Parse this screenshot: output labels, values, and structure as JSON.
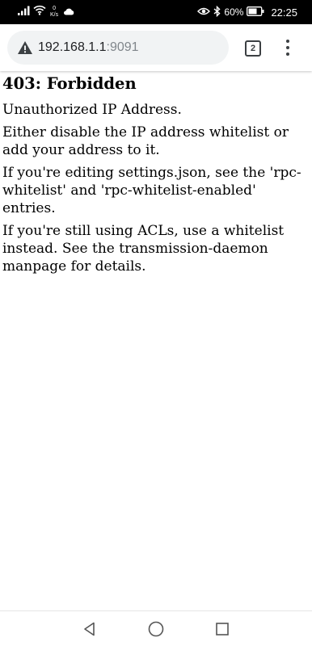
{
  "status_bar": {
    "net_speed_value": "0",
    "net_speed_unit": "K/s",
    "battery_percent": "60%",
    "time": "22:25"
  },
  "browser": {
    "url_host": "192.168.1.1",
    "url_port": ":9091",
    "tab_count": "2"
  },
  "page": {
    "heading": "403: Forbidden",
    "paragraphs": [
      "Unauthorized IP Address.",
      "Either disable the IP address whitelist or add your address to it.",
      "If you're editing settings.json, see the 'rpc-whitelist' and 'rpc-whitelist-enabled' entries.",
      "If you're still using ACLs, use a whitelist instead. See the transmission-daemon manpage for details."
    ]
  },
  "icons": {
    "signal": "signal-icon",
    "wifi": "wifi-icon",
    "cloud": "cloud-icon",
    "eye": "eye-comfort-icon",
    "bluetooth": "bluetooth-icon",
    "battery": "battery-icon",
    "warning": "not-secure-warning-icon",
    "menu": "more-vert-icon",
    "back": "back-icon",
    "home": "home-icon",
    "recent": "recent-apps-icon"
  },
  "colors": {
    "status_bar_bg": "#000000",
    "url_bar_bg": "#f1f3f4",
    "url_port_text": "#80868b"
  }
}
